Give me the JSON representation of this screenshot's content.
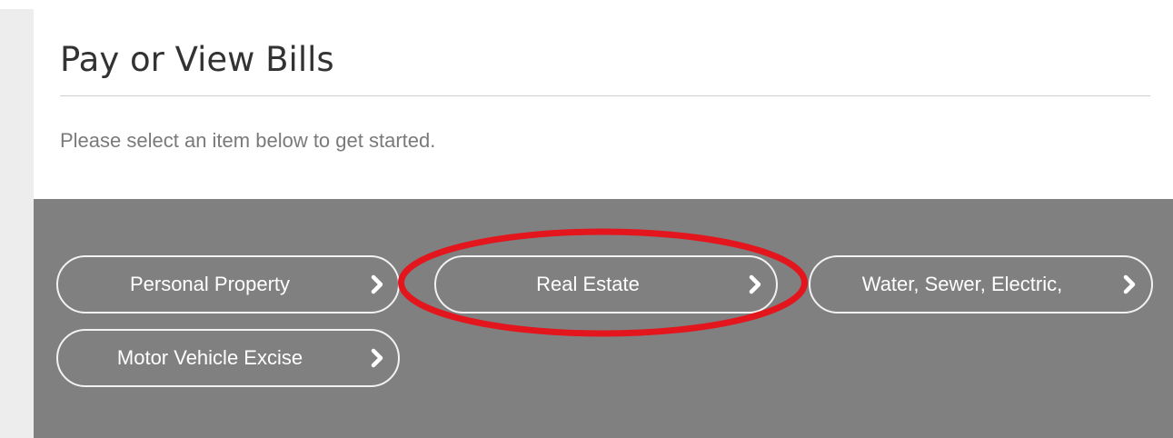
{
  "header": {
    "title": "Pay or View Bills",
    "instructions": "Please select an item below to get started."
  },
  "bill_types": [
    {
      "label": "Personal Property",
      "icon": "chevron-right-icon"
    },
    {
      "label": "Real Estate",
      "icon": "chevron-right-icon"
    },
    {
      "label": "Water, Sewer, Electric,",
      "icon": "chevron-right-icon"
    },
    {
      "label": "Motor Vehicle Excise",
      "icon": "chevron-right-icon"
    }
  ],
  "colors": {
    "panel_background": "#808080",
    "button_border": "#f2f2f2",
    "highlight_ring": "#e3161d",
    "title_text": "#333333",
    "instruction_text": "#7a7a7a"
  }
}
